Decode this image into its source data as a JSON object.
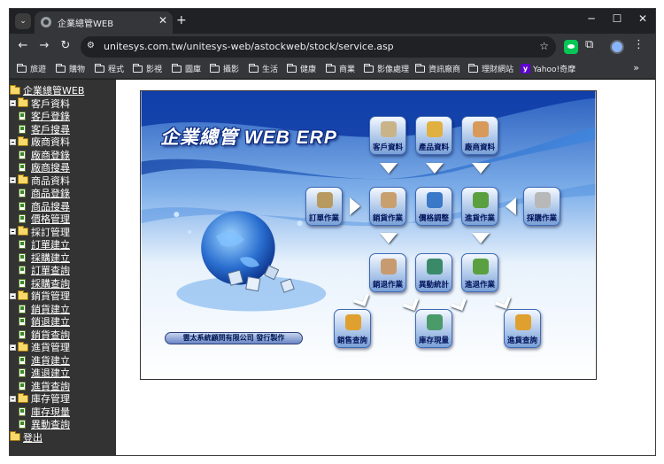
{
  "browser": {
    "tab_title": "企業總管WEB",
    "new_tab_label": "+",
    "url": "unitesys.com.tw/unitesys-web/astockweb/stock/service.asp",
    "bookmarks": [
      "旅遊",
      "購物",
      "程式",
      "影視",
      "圖庫",
      "攝影",
      "生活",
      "健康",
      "商業",
      "影像處理",
      "資訊廠商",
      "理財網站",
      "Yahoo!奇摩"
    ]
  },
  "sidebar": {
    "root": "企業總管WEB",
    "categories": [
      {
        "label": "客戶資料",
        "items": [
          "客戶登錄",
          "客戶搜尋"
        ]
      },
      {
        "label": "廠商資料",
        "items": [
          "廠商登錄",
          "廠商搜尋"
        ]
      },
      {
        "label": "商品資料",
        "items": [
          "商品登錄",
          "商品搜尋",
          "價格管理"
        ]
      },
      {
        "label": "採訂管理",
        "items": [
          "訂單建立",
          "採購建立",
          "訂單查詢",
          "採購查詢"
        ]
      },
      {
        "label": "銷貨管理",
        "items": [
          "銷貨建立",
          "銷退建立",
          "銷貨查詢"
        ]
      },
      {
        "label": "進貨管理",
        "items": [
          "進貨建立",
          "進退建立",
          "進貨查詢"
        ]
      },
      {
        "label": "庫存管理",
        "items": [
          "庫存現量",
          "異動查詢"
        ]
      }
    ],
    "logout": "登出"
  },
  "main": {
    "erp_title": "企業總管 WEB ERP",
    "company": "雲太系統顧問有限公司 發行製作",
    "modules": {
      "customer": "客戶資料",
      "product": "產品資料",
      "vendor": "廠商資料",
      "order": "訂單作業",
      "sales": "銷貨作業",
      "price": "價格調整",
      "purchase_in": "進貨作業",
      "purchasing": "採購作業",
      "sales_return": "銷退作業",
      "stats": "異動統計",
      "purchase_return": "進退作業",
      "sales_query": "銷售查詢",
      "stock": "庫存現量",
      "purchase_query": "進貨查詢"
    },
    "module_colors": {
      "customer": "#c9b48a",
      "product": "#e0b040",
      "vendor": "#d89a5a",
      "order": "#b89a60",
      "sales": "#c8a070",
      "price": "#3a78c8",
      "purchase_in": "#5aa040",
      "purchasing": "#b8b8b8",
      "sales_return": "#c89a70",
      "stats": "#3a8a6a",
      "purchase_return": "#5aa040",
      "sales_query": "#e0a030",
      "stock": "#4a9a6a",
      "purchase_query": "#e0a030"
    }
  }
}
